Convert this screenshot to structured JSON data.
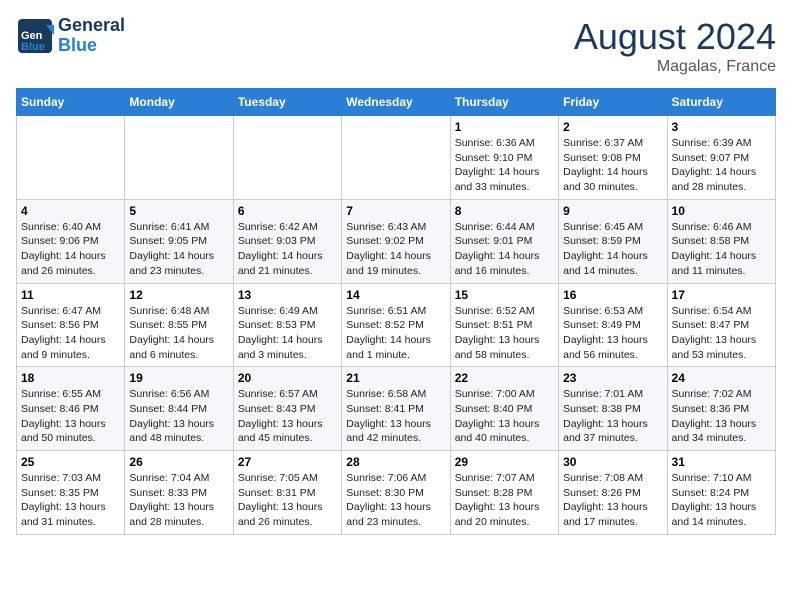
{
  "header": {
    "logo_line1": "General",
    "logo_line2": "Blue",
    "title": "August 2024",
    "location": "Magalas, France"
  },
  "weekdays": [
    "Sunday",
    "Monday",
    "Tuesday",
    "Wednesday",
    "Thursday",
    "Friday",
    "Saturday"
  ],
  "weeks": [
    [
      {
        "day": "",
        "info": ""
      },
      {
        "day": "",
        "info": ""
      },
      {
        "day": "",
        "info": ""
      },
      {
        "day": "",
        "info": ""
      },
      {
        "day": "1",
        "info": "Sunrise: 6:36 AM\nSunset: 9:10 PM\nDaylight: 14 hours\nand 33 minutes."
      },
      {
        "day": "2",
        "info": "Sunrise: 6:37 AM\nSunset: 9:08 PM\nDaylight: 14 hours\nand 30 minutes."
      },
      {
        "day": "3",
        "info": "Sunrise: 6:39 AM\nSunset: 9:07 PM\nDaylight: 14 hours\nand 28 minutes."
      }
    ],
    [
      {
        "day": "4",
        "info": "Sunrise: 6:40 AM\nSunset: 9:06 PM\nDaylight: 14 hours\nand 26 minutes."
      },
      {
        "day": "5",
        "info": "Sunrise: 6:41 AM\nSunset: 9:05 PM\nDaylight: 14 hours\nand 23 minutes."
      },
      {
        "day": "6",
        "info": "Sunrise: 6:42 AM\nSunset: 9:03 PM\nDaylight: 14 hours\nand 21 minutes."
      },
      {
        "day": "7",
        "info": "Sunrise: 6:43 AM\nSunset: 9:02 PM\nDaylight: 14 hours\nand 19 minutes."
      },
      {
        "day": "8",
        "info": "Sunrise: 6:44 AM\nSunset: 9:01 PM\nDaylight: 14 hours\nand 16 minutes."
      },
      {
        "day": "9",
        "info": "Sunrise: 6:45 AM\nSunset: 8:59 PM\nDaylight: 14 hours\nand 14 minutes."
      },
      {
        "day": "10",
        "info": "Sunrise: 6:46 AM\nSunset: 8:58 PM\nDaylight: 14 hours\nand 11 minutes."
      }
    ],
    [
      {
        "day": "11",
        "info": "Sunrise: 6:47 AM\nSunset: 8:56 PM\nDaylight: 14 hours\nand 9 minutes."
      },
      {
        "day": "12",
        "info": "Sunrise: 6:48 AM\nSunset: 8:55 PM\nDaylight: 14 hours\nand 6 minutes."
      },
      {
        "day": "13",
        "info": "Sunrise: 6:49 AM\nSunset: 8:53 PM\nDaylight: 14 hours\nand 3 minutes."
      },
      {
        "day": "14",
        "info": "Sunrise: 6:51 AM\nSunset: 8:52 PM\nDaylight: 14 hours\nand 1 minute."
      },
      {
        "day": "15",
        "info": "Sunrise: 6:52 AM\nSunset: 8:51 PM\nDaylight: 13 hours\nand 58 minutes."
      },
      {
        "day": "16",
        "info": "Sunrise: 6:53 AM\nSunset: 8:49 PM\nDaylight: 13 hours\nand 56 minutes."
      },
      {
        "day": "17",
        "info": "Sunrise: 6:54 AM\nSunset: 8:47 PM\nDaylight: 13 hours\nand 53 minutes."
      }
    ],
    [
      {
        "day": "18",
        "info": "Sunrise: 6:55 AM\nSunset: 8:46 PM\nDaylight: 13 hours\nand 50 minutes."
      },
      {
        "day": "19",
        "info": "Sunrise: 6:56 AM\nSunset: 8:44 PM\nDaylight: 13 hours\nand 48 minutes."
      },
      {
        "day": "20",
        "info": "Sunrise: 6:57 AM\nSunset: 8:43 PM\nDaylight: 13 hours\nand 45 minutes."
      },
      {
        "day": "21",
        "info": "Sunrise: 6:58 AM\nSunset: 8:41 PM\nDaylight: 13 hours\nand 42 minutes."
      },
      {
        "day": "22",
        "info": "Sunrise: 7:00 AM\nSunset: 8:40 PM\nDaylight: 13 hours\nand 40 minutes."
      },
      {
        "day": "23",
        "info": "Sunrise: 7:01 AM\nSunset: 8:38 PM\nDaylight: 13 hours\nand 37 minutes."
      },
      {
        "day": "24",
        "info": "Sunrise: 7:02 AM\nSunset: 8:36 PM\nDaylight: 13 hours\nand 34 minutes."
      }
    ],
    [
      {
        "day": "25",
        "info": "Sunrise: 7:03 AM\nSunset: 8:35 PM\nDaylight: 13 hours\nand 31 minutes."
      },
      {
        "day": "26",
        "info": "Sunrise: 7:04 AM\nSunset: 8:33 PM\nDaylight: 13 hours\nand 28 minutes."
      },
      {
        "day": "27",
        "info": "Sunrise: 7:05 AM\nSunset: 8:31 PM\nDaylight: 13 hours\nand 26 minutes."
      },
      {
        "day": "28",
        "info": "Sunrise: 7:06 AM\nSunset: 8:30 PM\nDaylight: 13 hours\nand 23 minutes."
      },
      {
        "day": "29",
        "info": "Sunrise: 7:07 AM\nSunset: 8:28 PM\nDaylight: 13 hours\nand 20 minutes."
      },
      {
        "day": "30",
        "info": "Sunrise: 7:08 AM\nSunset: 8:26 PM\nDaylight: 13 hours\nand 17 minutes."
      },
      {
        "day": "31",
        "info": "Sunrise: 7:10 AM\nSunset: 8:24 PM\nDaylight: 13 hours\nand 14 minutes."
      }
    ]
  ]
}
